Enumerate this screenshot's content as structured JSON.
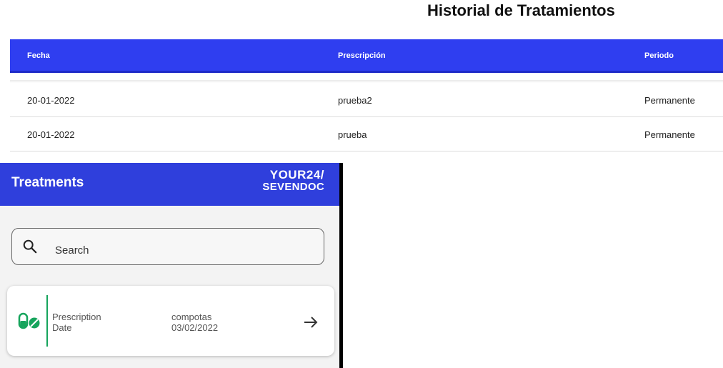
{
  "web": {
    "title": "Historial de Tratamientos",
    "columns": [
      "Fecha",
      "Prescripción",
      "Periodo"
    ],
    "rows": [
      {
        "date": "20-01-2022",
        "prescription": "prueba2",
        "period": "Permanente"
      },
      {
        "date": "20-01-2022",
        "prescription": "prueba",
        "period": "Permanente"
      }
    ],
    "header_color": "#2f3ef0"
  },
  "app": {
    "title": "Treatments",
    "logo": {
      "line1": "YOUR24/",
      "line2": "SEVENDOC"
    },
    "search": {
      "placeholder": "Search",
      "icon": "search-icon"
    },
    "cards": [
      {
        "icon": "pill-icon",
        "label_prescription": "Prescription",
        "label_date": "Date",
        "prescription": "compotas",
        "date": "03/02/2022",
        "action_icon": "arrow-right-icon"
      }
    ],
    "bar_color": "#2f3fdc",
    "accent_color": "#16a45c"
  }
}
